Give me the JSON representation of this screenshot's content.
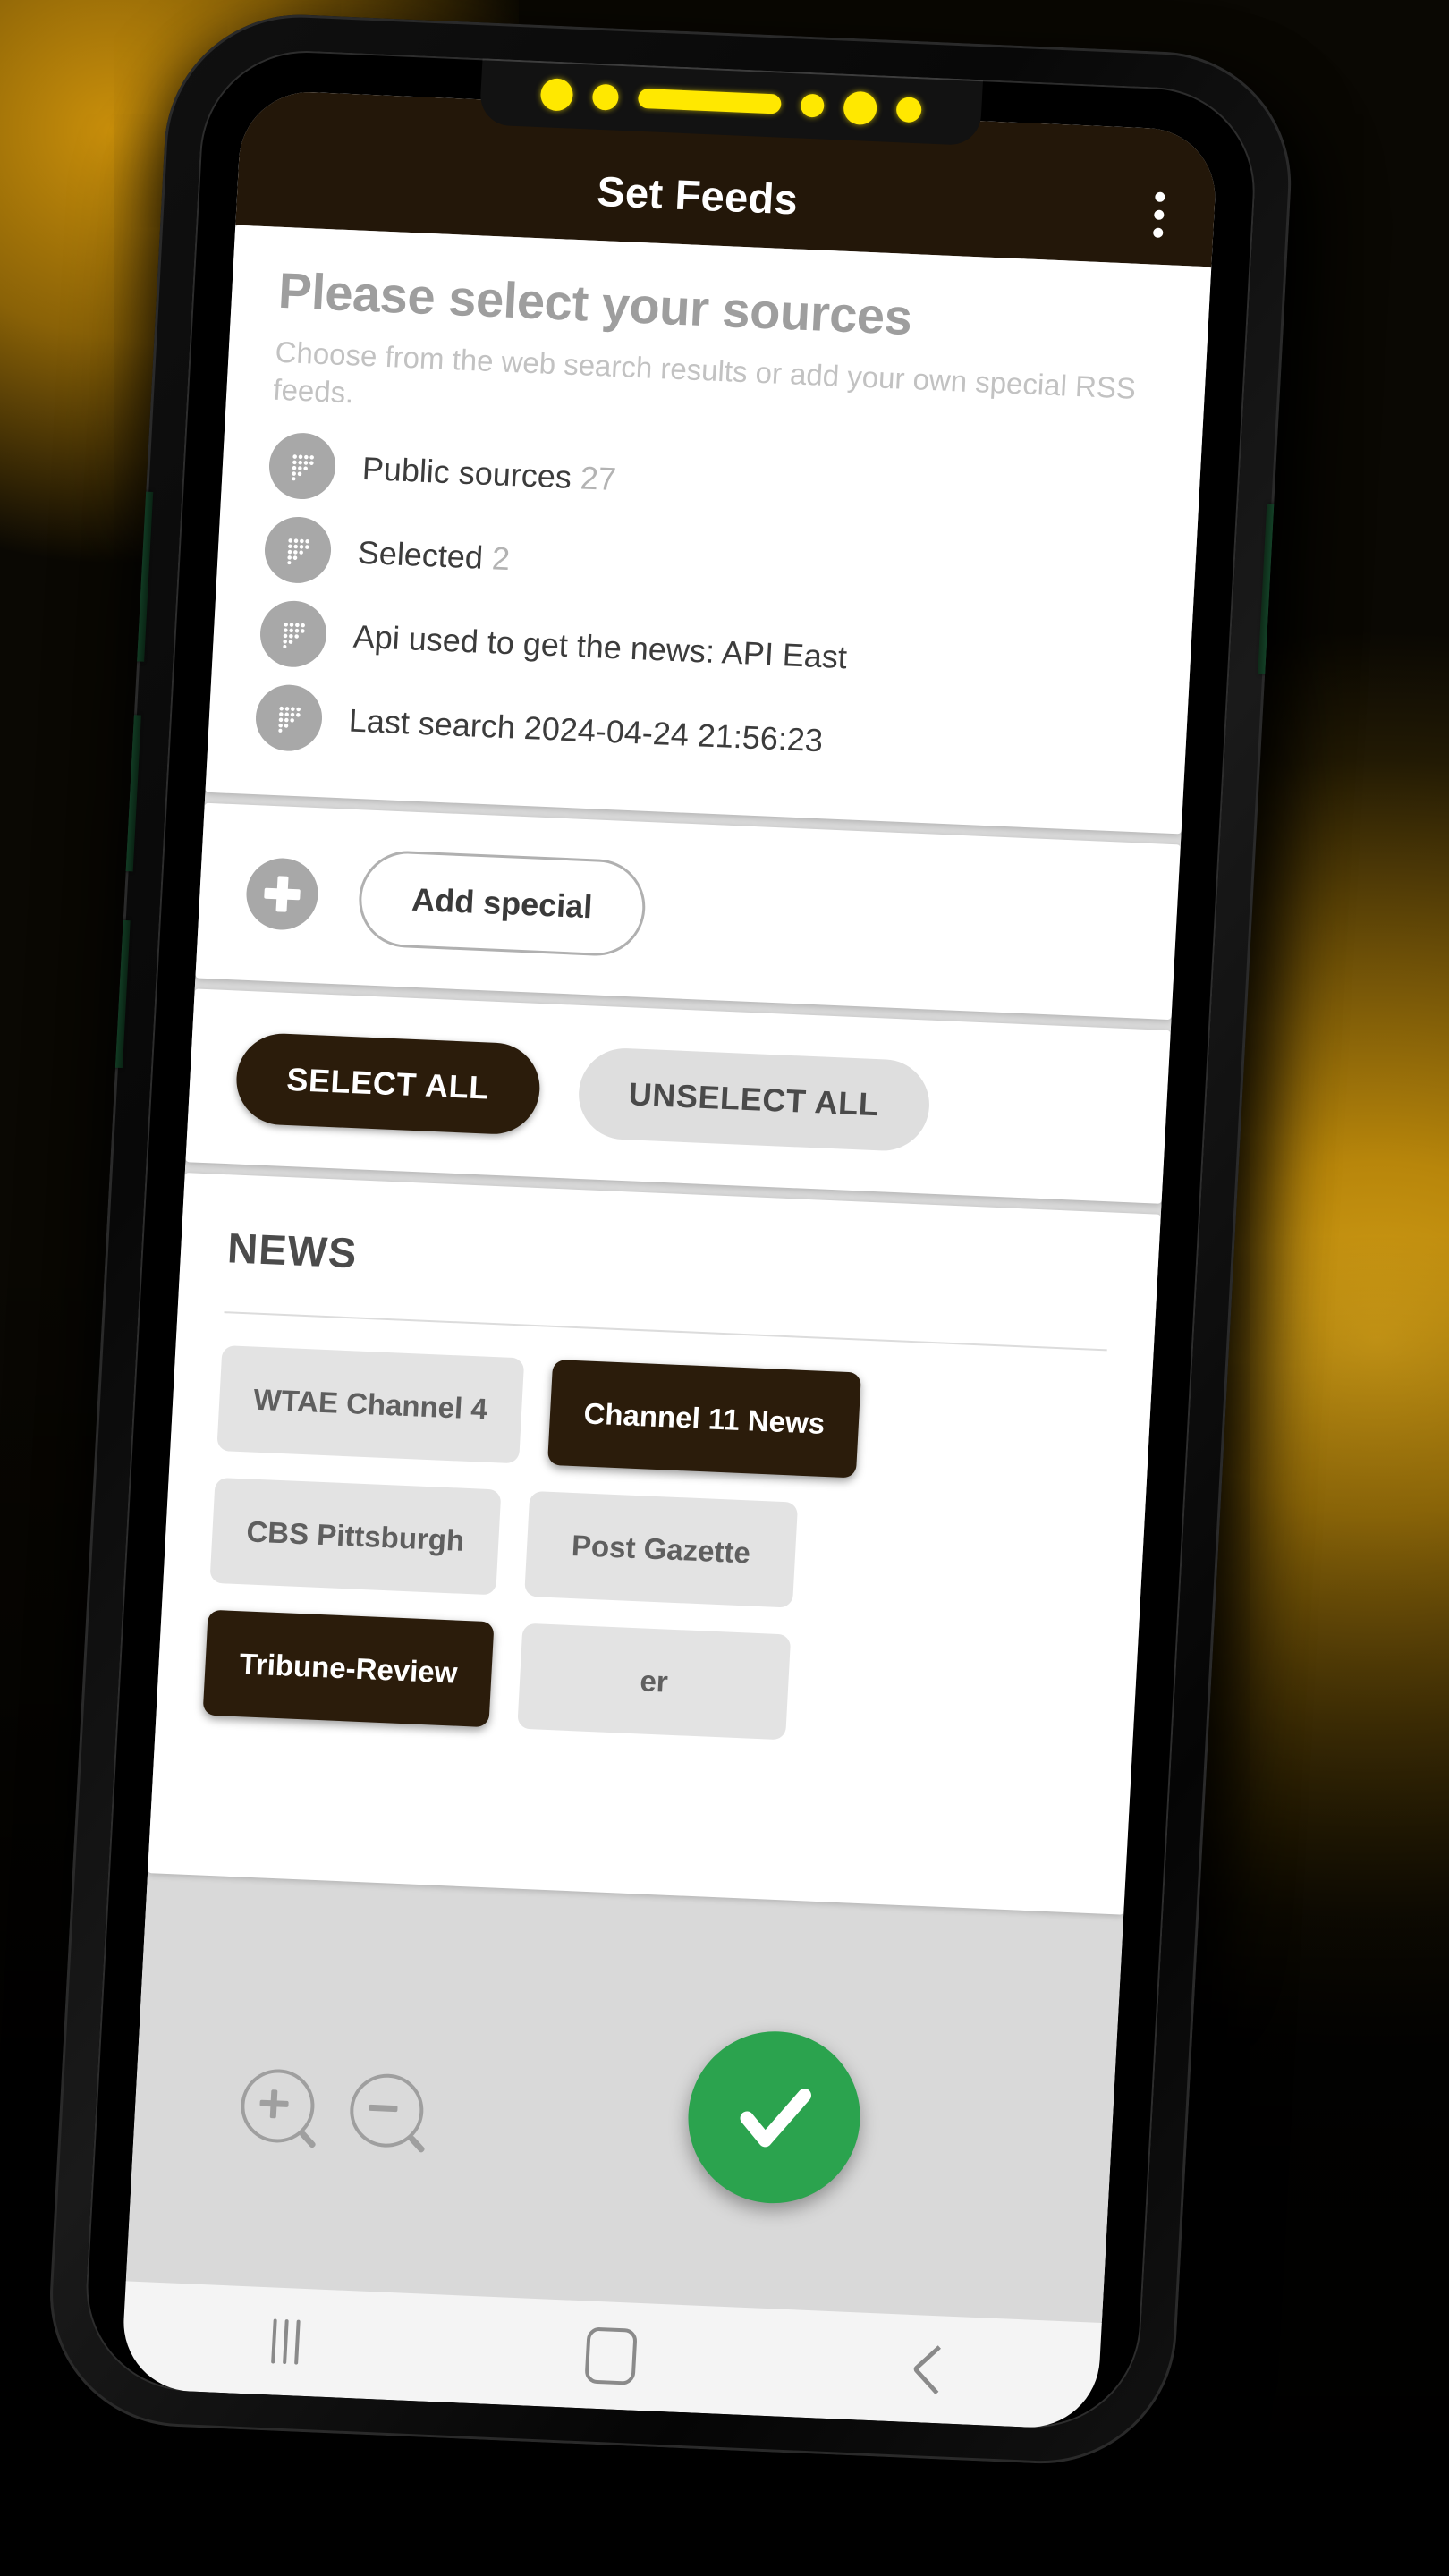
{
  "app": {
    "title": "Set Feeds",
    "overflow_icon": "kebab-menu-icon"
  },
  "header": {
    "headline": "Please select your sources",
    "subhead": "Choose from the web search results or add your own special RSS feeds."
  },
  "info_rows": [
    {
      "icon": "feed-dots-icon",
      "label": "Public sources",
      "value": "27"
    },
    {
      "icon": "feed-dots-icon",
      "label": "Selected",
      "value": "2"
    },
    {
      "icon": "feed-dots-icon",
      "label": "Api used to get the news: API East",
      "value": ""
    },
    {
      "icon": "feed-dots-icon",
      "label": "Last search 2024-04-24 21:56:23",
      "value": ""
    }
  ],
  "add_section": {
    "plus_icon": "plus-circle-icon",
    "button_label": "Add special"
  },
  "select_section": {
    "select_all_label": "SELECT ALL",
    "unselect_all_label": "UNSELECT ALL"
  },
  "news_section": {
    "title": "NEWS",
    "chips": [
      {
        "label": "WTAE Channel 4",
        "selected": false
      },
      {
        "label": "Channel 11 News",
        "selected": true
      },
      {
        "label": "CBS Pittsburgh",
        "selected": false
      },
      {
        "label": "Post Gazette",
        "selected": false
      },
      {
        "label": "Tribune-Review",
        "selected": true
      },
      {
        "label": "er",
        "selected": false
      }
    ]
  },
  "overlay": {
    "zoom_in_icon": "zoom-in-icon",
    "zoom_out_icon": "zoom-out-icon",
    "confirm_icon": "checkmark-icon"
  },
  "nav_bar": {
    "recents_icon": "recents-icon",
    "home_icon": "home-icon",
    "back_icon": "back-icon"
  },
  "colors": {
    "app_bar": "#231709",
    "selected_chip": "#2b1c0b",
    "confirm_fab": "#2ba34e",
    "notch_led": "#ffe800",
    "backdrop_gold": "#b8860b"
  }
}
